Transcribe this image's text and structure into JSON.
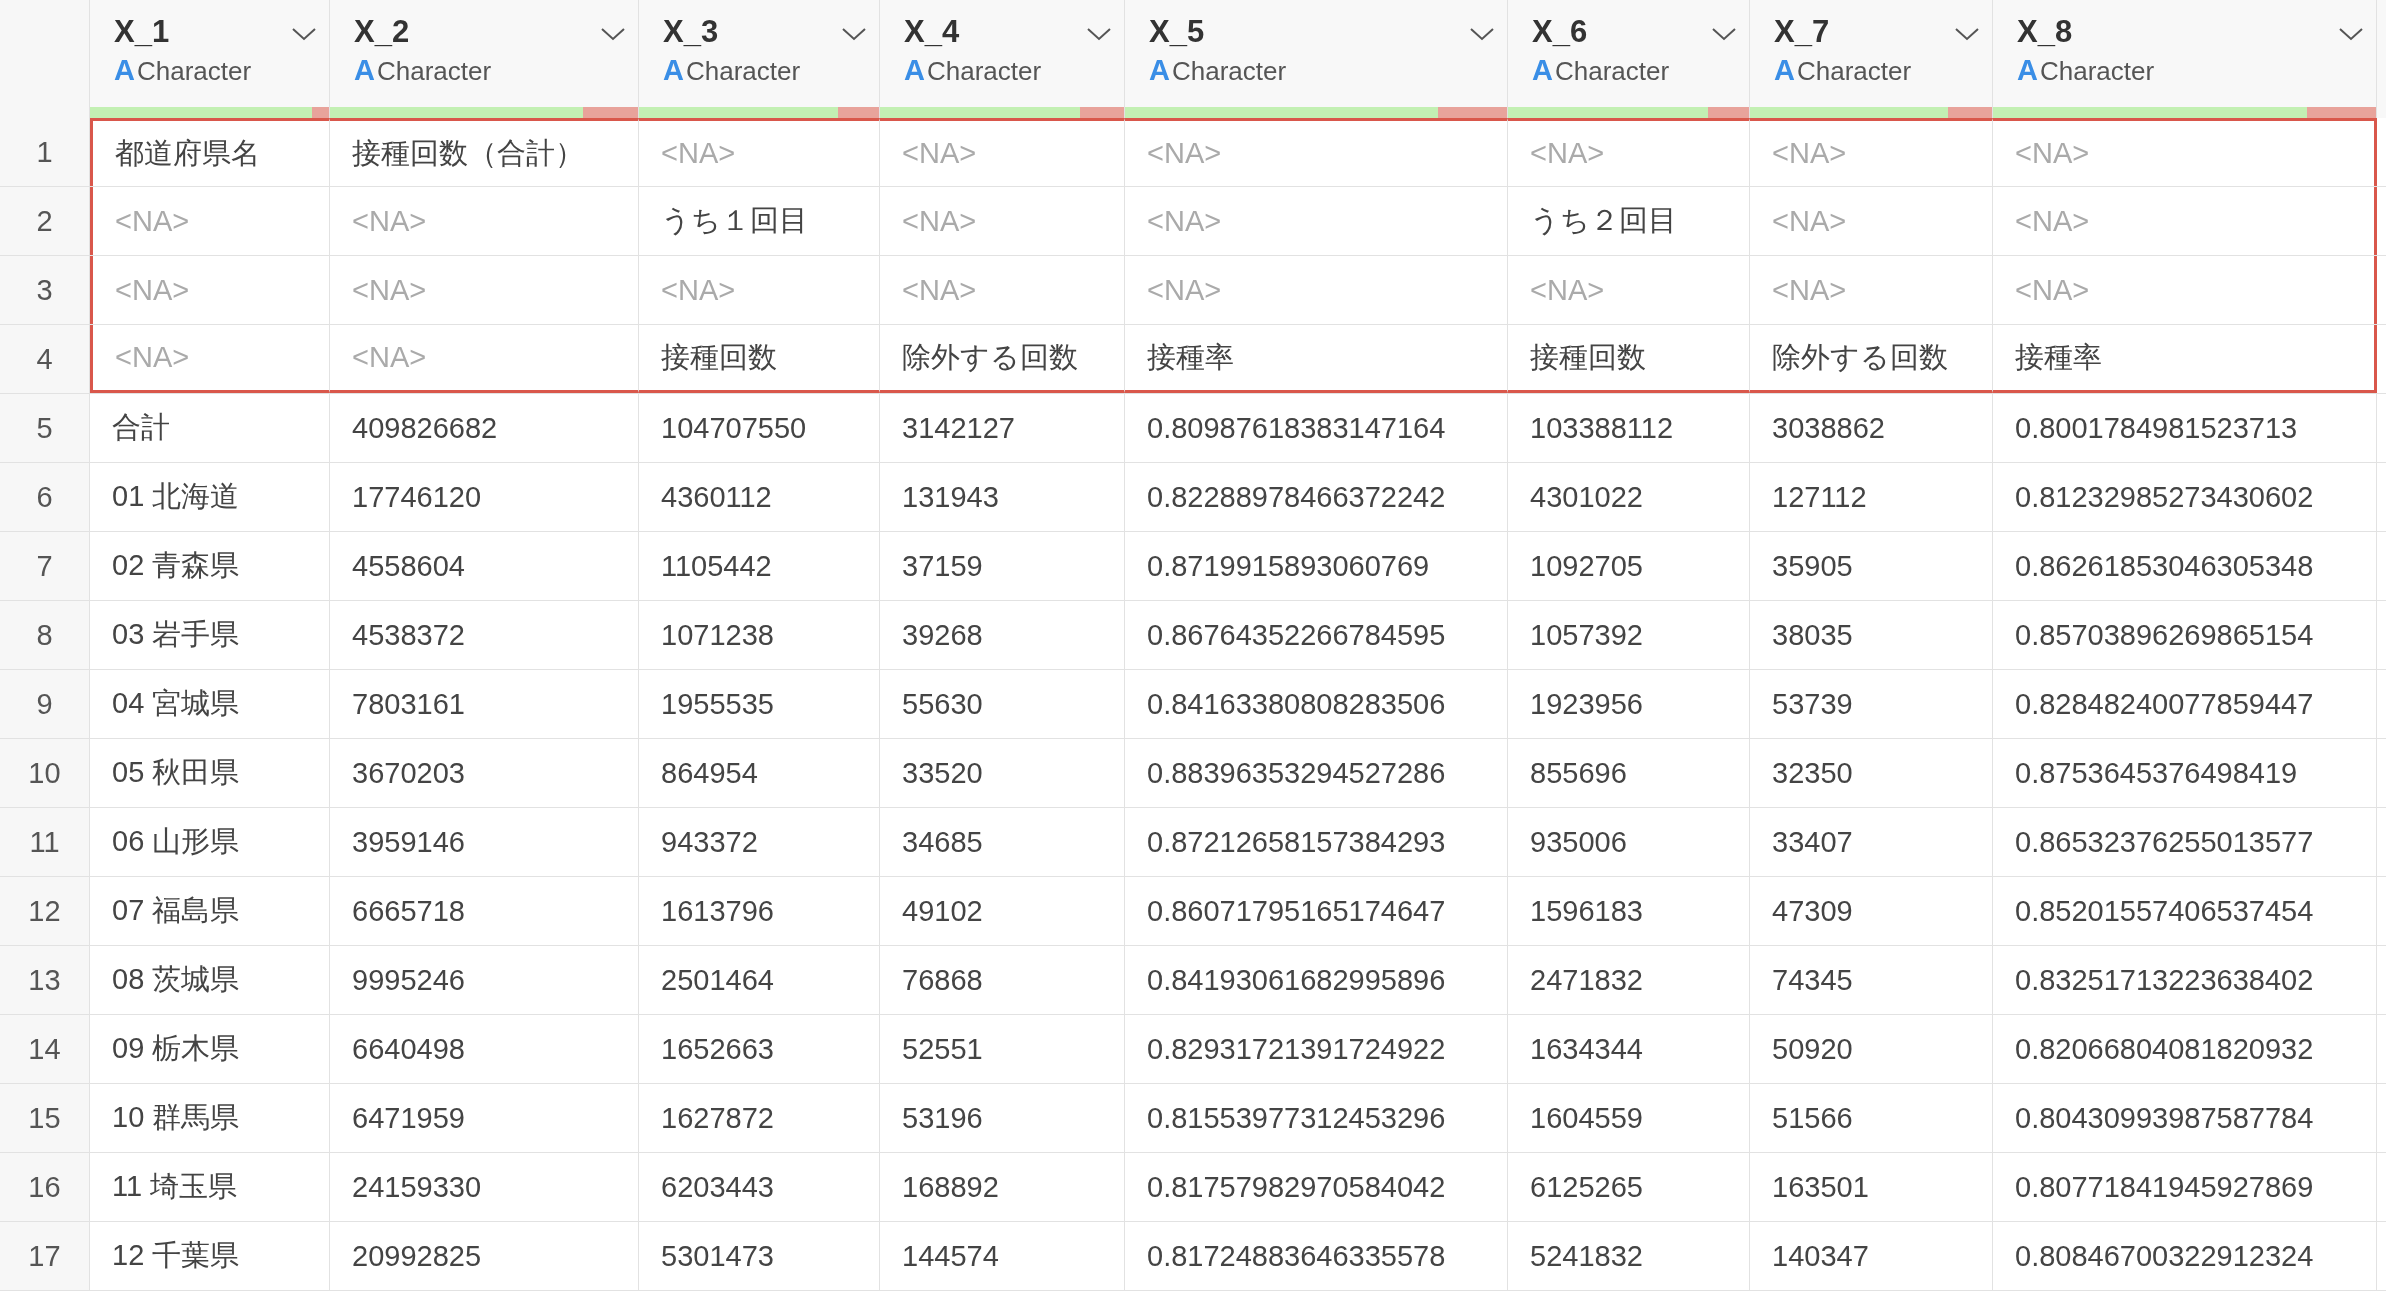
{
  "columns": [
    {
      "name": "X_1",
      "type_icon": "A",
      "type": "Character",
      "level": 0.93
    },
    {
      "name": "X_2",
      "type_icon": "A",
      "type": "Character",
      "level": 0.82
    },
    {
      "name": "X_3",
      "type_icon": "A",
      "type": "Character",
      "level": 0.83
    },
    {
      "name": "X_4",
      "type_icon": "A",
      "type": "Character",
      "level": 0.82
    },
    {
      "name": "X_5",
      "type_icon": "A",
      "type": "Character",
      "level": 0.82
    },
    {
      "name": "X_6",
      "type_icon": "A",
      "type": "Character",
      "level": 0.83
    },
    {
      "name": "X_7",
      "type_icon": "A",
      "type": "Character",
      "level": 0.82
    },
    {
      "name": "X_8",
      "type_icon": "A",
      "type": "Character",
      "level": 0.82
    }
  ],
  "rows": [
    {
      "number": "1",
      "highlighted": true,
      "cells": [
        "都道府県名",
        "接種回数（合計）",
        "<NA>",
        "<NA>",
        "<NA>",
        "<NA>",
        "<NA>",
        "<NA>"
      ],
      "missing": [
        false,
        false,
        true,
        true,
        true,
        true,
        true,
        true
      ]
    },
    {
      "number": "2",
      "highlighted": true,
      "cells": [
        "<NA>",
        "<NA>",
        "うち１回目",
        "<NA>",
        "<NA>",
        "うち２回目",
        "<NA>",
        "<NA>"
      ],
      "missing": [
        true,
        true,
        false,
        true,
        true,
        false,
        true,
        true
      ]
    },
    {
      "number": "3",
      "highlighted": true,
      "cells": [
        "<NA>",
        "<NA>",
        "<NA>",
        "<NA>",
        "<NA>",
        "<NA>",
        "<NA>",
        "<NA>"
      ],
      "missing": [
        true,
        true,
        true,
        true,
        true,
        true,
        true,
        true
      ]
    },
    {
      "number": "4",
      "highlighted": true,
      "cells": [
        "<NA>",
        "<NA>",
        "接種回数",
        "除外する回数",
        "接種率",
        "接種回数",
        "除外する回数",
        "接種率"
      ],
      "missing": [
        true,
        true,
        false,
        false,
        false,
        false,
        false,
        false
      ]
    },
    {
      "number": "5",
      "highlighted": false,
      "cells": [
        "合計",
        "409826682",
        "104707550",
        "3142127",
        "0.80987618383147164",
        "103388112",
        "3038862",
        "0.8001784981523713"
      ],
      "missing": [
        false,
        false,
        false,
        false,
        false,
        false,
        false,
        false
      ]
    },
    {
      "number": "6",
      "highlighted": false,
      "cells": [
        "01 北海道",
        "17746120",
        "4360112",
        "131943",
        "0.82288978466372242",
        "4301022",
        "127112",
        "0.81232985273430602"
      ],
      "missing": [
        false,
        false,
        false,
        false,
        false,
        false,
        false,
        false
      ]
    },
    {
      "number": "7",
      "highlighted": false,
      "cells": [
        "02 青森県",
        "4558604",
        "1105442",
        "37159",
        "0.8719915893060769",
        "1092705",
        "35905",
        "0.86261853046305348"
      ],
      "missing": [
        false,
        false,
        false,
        false,
        false,
        false,
        false,
        false
      ]
    },
    {
      "number": "8",
      "highlighted": false,
      "cells": [
        "03 岩手県",
        "4538372",
        "1071238",
        "39268",
        "0.86764352266784595",
        "1057392",
        "38035",
        "0.85703896269865154"
      ],
      "missing": [
        false,
        false,
        false,
        false,
        false,
        false,
        false,
        false
      ]
    },
    {
      "number": "9",
      "highlighted": false,
      "cells": [
        "04 宮城県",
        "7803161",
        "1955535",
        "55630",
        "0.84163380808283506",
        "1923956",
        "53739",
        "0.82848240077859447"
      ],
      "missing": [
        false,
        false,
        false,
        false,
        false,
        false,
        false,
        false
      ]
    },
    {
      "number": "10",
      "highlighted": false,
      "cells": [
        "05 秋田県",
        "3670203",
        "864954",
        "33520",
        "0.88396353294527286",
        "855696",
        "32350",
        "0.8753645376498419"
      ],
      "missing": [
        false,
        false,
        false,
        false,
        false,
        false,
        false,
        false
      ]
    },
    {
      "number": "11",
      "highlighted": false,
      "cells": [
        "06 山形県",
        "3959146",
        "943372",
        "34685",
        "0.87212658157384293",
        "935006",
        "33407",
        "0.86532376255013577"
      ],
      "missing": [
        false,
        false,
        false,
        false,
        false,
        false,
        false,
        false
      ]
    },
    {
      "number": "12",
      "highlighted": false,
      "cells": [
        "07 福島県",
        "6665718",
        "1613796",
        "49102",
        "0.86071795165174647",
        "1596183",
        "47309",
        "0.85201557406537454"
      ],
      "missing": [
        false,
        false,
        false,
        false,
        false,
        false,
        false,
        false
      ]
    },
    {
      "number": "13",
      "highlighted": false,
      "cells": [
        "08 茨城県",
        "9995246",
        "2501464",
        "76868",
        "0.84193061682995896",
        "2471832",
        "74345",
        "0.83251713223638402"
      ],
      "missing": [
        false,
        false,
        false,
        false,
        false,
        false,
        false,
        false
      ]
    },
    {
      "number": "14",
      "highlighted": false,
      "cells": [
        "09 栃木県",
        "6640498",
        "1652663",
        "52551",
        "0.82931721391724922",
        "1634344",
        "50920",
        "0.82066804081820932"
      ],
      "missing": [
        false,
        false,
        false,
        false,
        false,
        false,
        false,
        false
      ]
    },
    {
      "number": "15",
      "highlighted": false,
      "cells": [
        "10 群馬県",
        "6471959",
        "1627872",
        "53196",
        "0.81553977312453296",
        "1604559",
        "51566",
        "0.80430993987587784"
      ],
      "missing": [
        false,
        false,
        false,
        false,
        false,
        false,
        false,
        false
      ]
    },
    {
      "number": "16",
      "highlighted": false,
      "cells": [
        "11 埼玉県",
        "24159330",
        "6203443",
        "168892",
        "0.81757982970584042",
        "6125265",
        "163501",
        "0.80771841945927869"
      ],
      "missing": [
        false,
        false,
        false,
        false,
        false,
        false,
        false,
        false
      ]
    },
    {
      "number": "17",
      "highlighted": false,
      "cells": [
        "12 千葉県",
        "20992825",
        "5301473",
        "144574",
        "0.81724883646335578",
        "5241832",
        "140347",
        "0.80846700322912324"
      ],
      "missing": [
        false,
        false,
        false,
        false,
        false,
        false,
        false,
        false
      ]
    }
  ]
}
